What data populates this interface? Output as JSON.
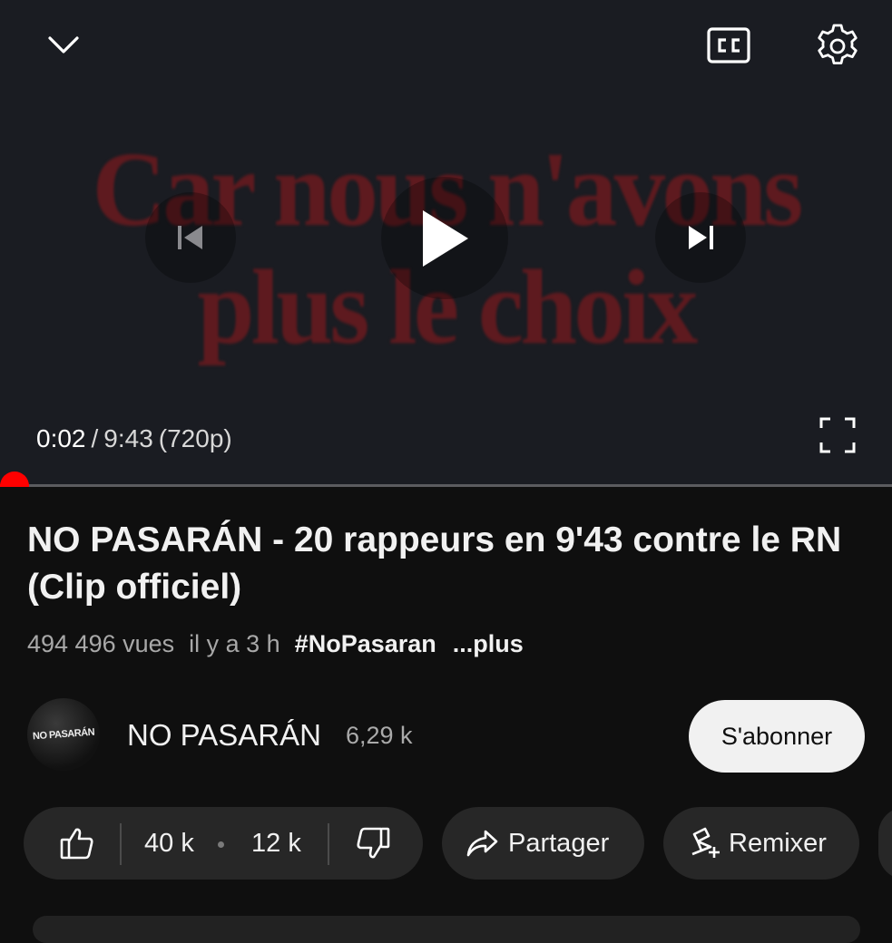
{
  "player": {
    "frame_text": {
      "line1": "Car nous n'avons",
      "line2": "plus le choix"
    },
    "time_current": "0:02",
    "time_separator": "/",
    "time_total": "9:43",
    "quality": "(720p)",
    "progress_fraction": 0.003,
    "icons": {
      "collapse": "chevron-down-icon",
      "captions": "closed-captions-icon",
      "settings": "gear-icon",
      "previous": "skip-previous-icon",
      "play": "play-icon",
      "next": "skip-next-icon",
      "fullscreen": "fullscreen-icon"
    }
  },
  "video": {
    "title": "NO PASARÁN - 20 rappeurs en 9'43 contre le RN (Clip officiel)",
    "views": "494 496 vues",
    "age": "il y a 3 h",
    "hashtag": "#NoPasaran",
    "more": "...plus"
  },
  "channel": {
    "avatar_text": "NO PASARÁN",
    "name": "NO PASARÁN",
    "subscribers": "6,29 k",
    "subscribe_label": "S'abonner"
  },
  "actions": {
    "likes": "40 k",
    "dislikes": "12 k",
    "share_label": "Partager",
    "remix_label": "Remixer"
  },
  "colors": {
    "background": "#0f0f0f",
    "accent": "#ff0000",
    "pill": "#272727",
    "subscribe_bg": "#f1f1f1"
  }
}
